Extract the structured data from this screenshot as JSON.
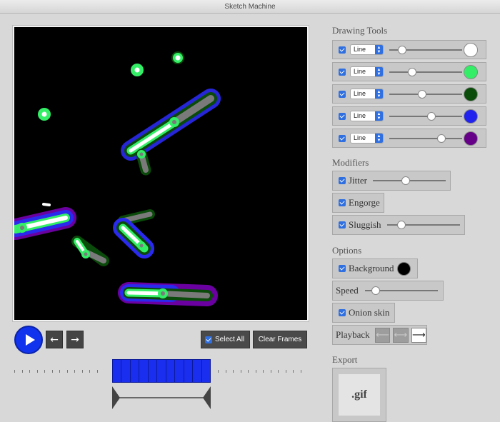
{
  "window": {
    "title": "Sketch Machine"
  },
  "controls": {
    "select_all_label": "Select All",
    "clear_frames_label": "Clear Frames",
    "back_arrow": "←",
    "forward_arrow": "→",
    "frame_count": 11
  },
  "drawing_tools": {
    "title": "Drawing Tools",
    "tools": [
      {
        "mode": "Line",
        "level": 0.18,
        "color": "#ffffff"
      },
      {
        "mode": "Line",
        "level": 0.31,
        "color": "#33ee66"
      },
      {
        "mode": "Line",
        "level": 0.45,
        "color": "#0a4d0a"
      },
      {
        "mode": "Line",
        "level": 0.58,
        "color": "#2222ee"
      },
      {
        "mode": "Line",
        "level": 0.72,
        "color": "#660088"
      }
    ]
  },
  "modifiers": {
    "title": "Modifiers",
    "jitter_label": "Jitter",
    "jitter_level": 0.45,
    "engorge_label": "Engorge",
    "sluggish_label": "Sluggish",
    "sluggish_level": 0.2
  },
  "options": {
    "title": "Options",
    "background_label": "Background",
    "background_color": "#000000",
    "speed_label": "Speed",
    "speed_level": 0.15,
    "onion_label": "Onion skin",
    "playback_label": "Playback",
    "playback_modes": [
      "⟵",
      "⟷",
      "⟶"
    ]
  },
  "export": {
    "title": "Export",
    "gif_label": ".gif"
  }
}
